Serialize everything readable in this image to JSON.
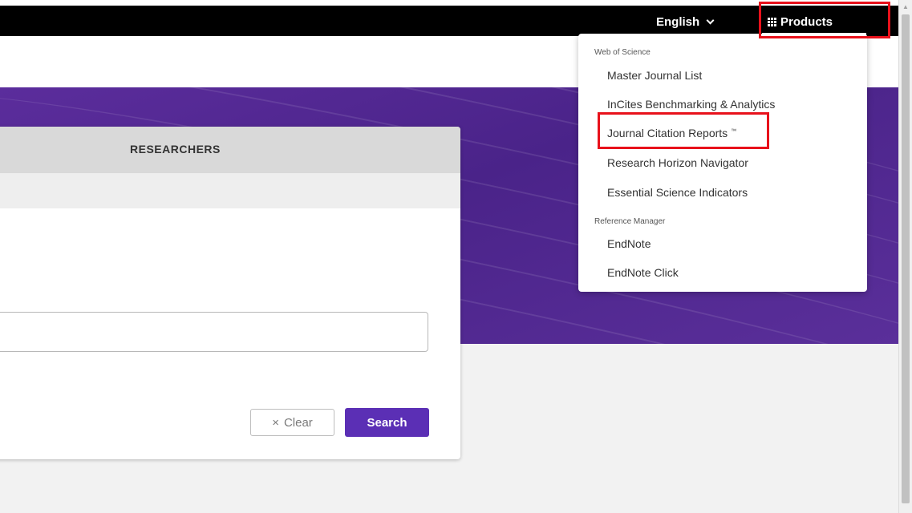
{
  "topbar": {
    "language": "English",
    "products_label": "Products"
  },
  "card": {
    "tab_researchers": "RESEARCHERS",
    "search_input": {
      "value": "",
      "placeholder": ""
    },
    "clear_label": "Clear",
    "clear_icon": "×",
    "search_label": "Search"
  },
  "products_menu": {
    "sections": [
      {
        "header": "Web of Science",
        "items": [
          "Master Journal List",
          "InCites Benchmarking & Analytics",
          "Journal Citation Reports",
          "Research Horizon Navigator",
          "Essential Science Indicators"
        ]
      },
      {
        "header": "Reference Manager",
        "items": [
          "EndNote",
          "EndNote Click"
        ]
      }
    ],
    "trademark": "™"
  },
  "colors": {
    "topbar": "#000000",
    "hero": "#4a2389",
    "accent": "#5b2fb5",
    "highlight": "#e8111b"
  }
}
